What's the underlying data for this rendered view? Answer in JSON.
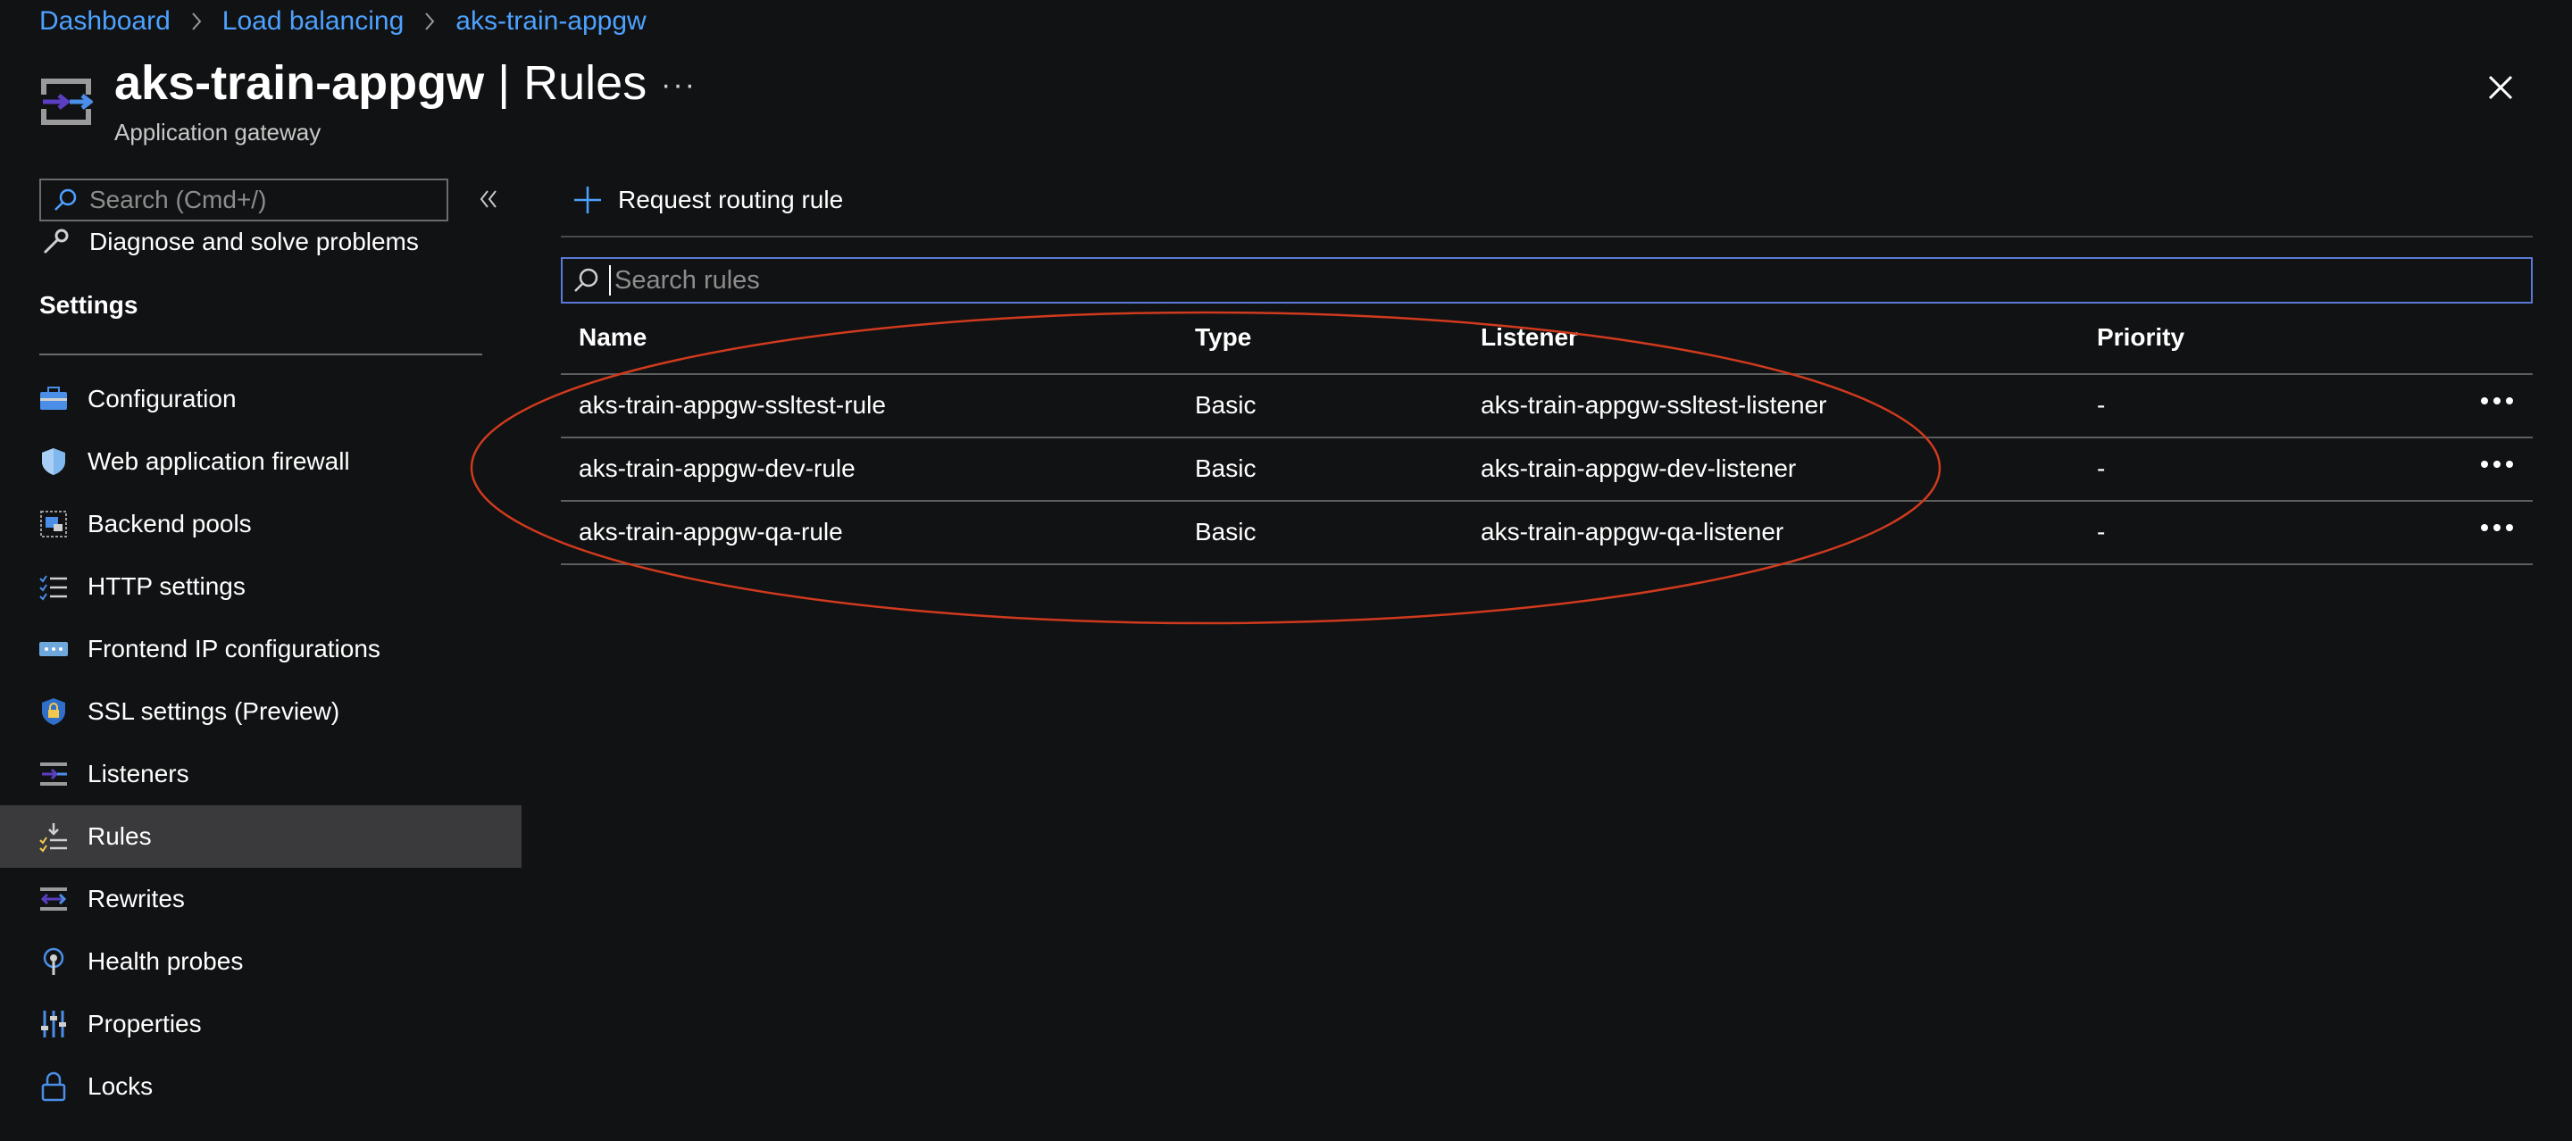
{
  "breadcrumb": [
    "Dashboard",
    "Load balancing",
    "aks-train-appgw"
  ],
  "header": {
    "resource_name": "aks-train-appgw",
    "separator": "|",
    "page_name": "Rules",
    "subtitle": "Application gateway",
    "more_icon": "ellipsis-icon",
    "close_icon": "close-icon"
  },
  "sidebar": {
    "search_placeholder": "Search (Cmd+/)",
    "collapse_icon": "double-chevron-left-icon",
    "partial_item": "Diagnose and solve problems",
    "section_title": "Settings",
    "items": [
      {
        "label": "Configuration",
        "icon": "configuration-icon"
      },
      {
        "label": "Web application firewall",
        "icon": "shield-icon"
      },
      {
        "label": "Backend pools",
        "icon": "backend-pools-icon"
      },
      {
        "label": "HTTP settings",
        "icon": "list-check-icon"
      },
      {
        "label": "Frontend IP configurations",
        "icon": "frontend-ip-icon"
      },
      {
        "label": "SSL settings (Preview)",
        "icon": "lock-shield-icon"
      },
      {
        "label": "Listeners",
        "icon": "listeners-icon"
      },
      {
        "label": "Rules",
        "icon": "rules-icon",
        "active": true
      },
      {
        "label": "Rewrites",
        "icon": "rewrites-icon"
      },
      {
        "label": "Health probes",
        "icon": "health-probe-icon"
      },
      {
        "label": "Properties",
        "icon": "properties-icon"
      },
      {
        "label": "Locks",
        "icon": "lock-icon"
      }
    ]
  },
  "toolbar": {
    "add_label": "Request routing rule",
    "add_icon": "plus-icon"
  },
  "search_rules": {
    "placeholder": "Search rules",
    "value": ""
  },
  "table": {
    "columns": [
      "Name",
      "Type",
      "Listener",
      "Priority"
    ],
    "rows": [
      {
        "name": "aks-train-appgw-ssltest-rule",
        "type": "Basic",
        "listener": "aks-train-appgw-ssltest-listener",
        "priority": "-"
      },
      {
        "name": "aks-train-appgw-dev-rule",
        "type": "Basic",
        "listener": "aks-train-appgw-dev-listener",
        "priority": "-"
      },
      {
        "name": "aks-train-appgw-qa-rule",
        "type": "Basic",
        "listener": "aks-train-appgw-qa-listener",
        "priority": "-"
      }
    ]
  },
  "colors": {
    "background": "#111213",
    "link": "#4da1ff",
    "active_item": "#3a3a3c",
    "search_focus": "#5a7ad8",
    "annotation": "#d03a1e"
  }
}
